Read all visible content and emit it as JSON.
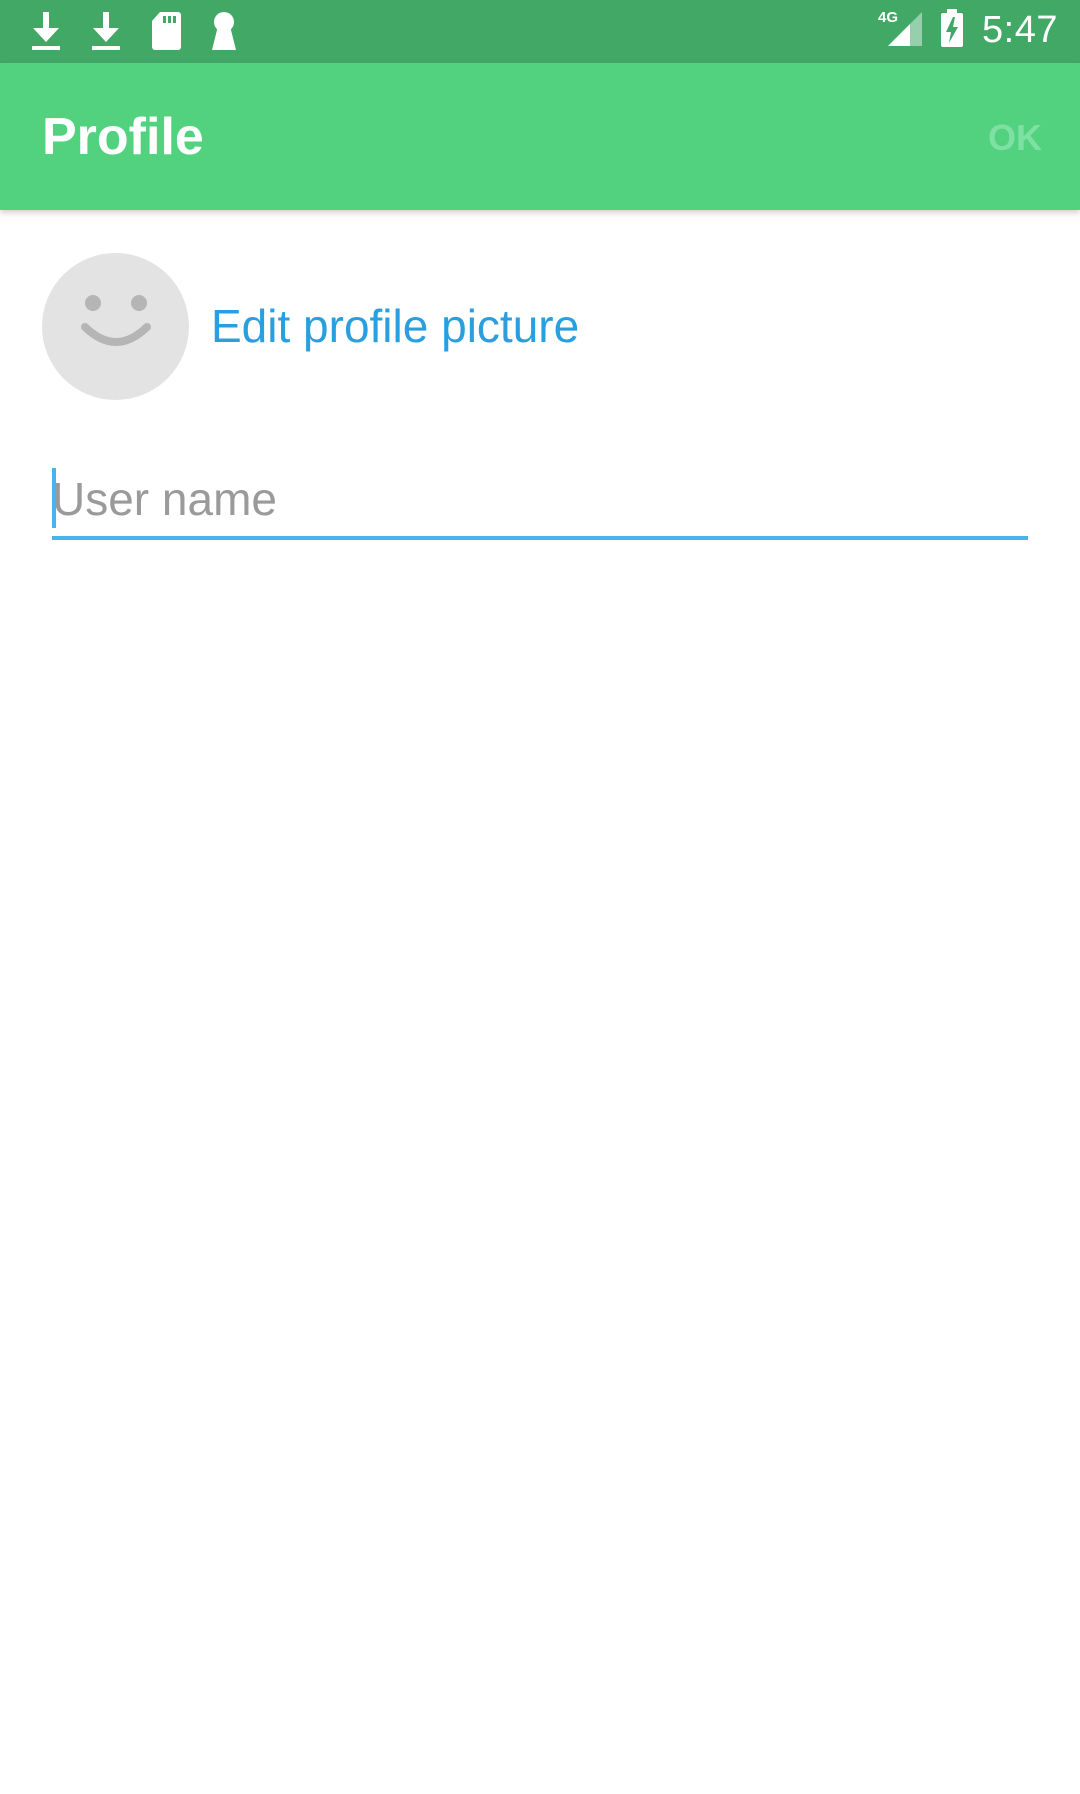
{
  "status_bar": {
    "time": "5:47",
    "network": "4G",
    "left_icons": [
      "download-icon",
      "download-icon",
      "sd-card-icon",
      "keyhole-icon"
    ],
    "right_icons": [
      "signal-icon",
      "battery-charging-icon"
    ],
    "background": "#41a866"
  },
  "app_bar": {
    "title": "Profile",
    "ok_label": "OK",
    "background": "#52d27f"
  },
  "profile": {
    "avatar_icon": "smiley-face-icon",
    "edit_picture_label": "Edit profile picture",
    "username_placeholder": "User name",
    "username_value": ""
  },
  "colors": {
    "accent": "#4ab3ee",
    "link": "#2a9fe0"
  }
}
